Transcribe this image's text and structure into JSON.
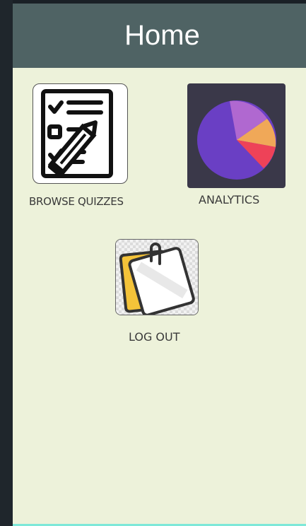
{
  "app_bar": {
    "title": "Home"
  },
  "tiles": {
    "browse": {
      "label": "BROWSE QUIZZES",
      "icon": "quiz-checklist-icon"
    },
    "analytics": {
      "label": "ANALYTICS",
      "icon": "pie-chart-icon"
    },
    "logout": {
      "label": "LOG OUT",
      "icon": "sticky-note-icon"
    }
  },
  "colors": {
    "app_bar": "#4f6364",
    "background": "#edf2da",
    "pie_purple": "#6a3fc4",
    "pie_lilac": "#b068d0",
    "pie_orange": "#f0a858",
    "pie_red": "#ee4258",
    "note_yellow": "#f4c339"
  }
}
